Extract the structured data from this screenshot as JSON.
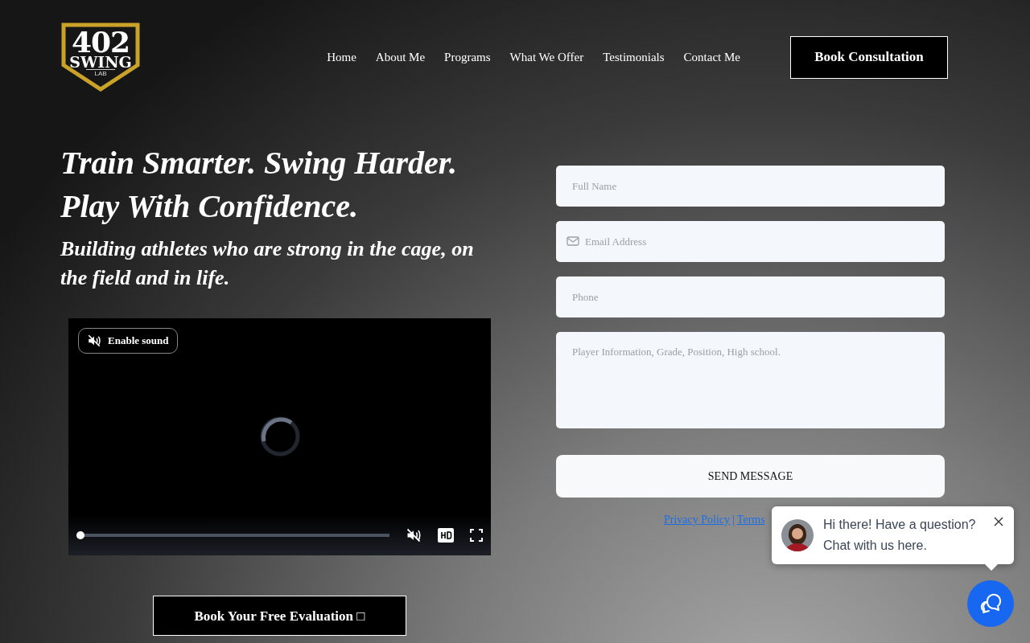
{
  "logo": {
    "number": "402",
    "word": "SWING",
    "sub": "LAB"
  },
  "nav": {
    "items": [
      {
        "label": "Home"
      },
      {
        "label": "About Me"
      },
      {
        "label": "Programs"
      },
      {
        "label": "What We Offer"
      },
      {
        "label": "Testimonials"
      },
      {
        "label": "Contact Me"
      }
    ],
    "cta": "Book Consultation"
  },
  "hero": {
    "headline": [
      "Train Smarter. Swing Harder.",
      "Play With Confidence."
    ],
    "subhead": "Building athletes who are strong in the cage, on the field and in life."
  },
  "video": {
    "sound_button": "Enable sound",
    "progress": {
      "level": 0
    }
  },
  "evaluation_button": "Book Your Free Evaluation □",
  "form": {
    "fields": [
      {
        "kind": "text",
        "placeholder": "Full Name"
      },
      {
        "kind": "email",
        "placeholder": "Email Address"
      },
      {
        "kind": "text",
        "placeholder": "Phone"
      },
      {
        "kind": "textarea",
        "placeholder": "Player Information, Grade, Position, High school."
      }
    ],
    "submit": "SEND MESSAGE",
    "links": [
      "Privacy Policy",
      "Terms"
    ],
    "separator": "|"
  },
  "chat": {
    "message": [
      "Hi there! Have a question?",
      "Chat with us here."
    ]
  }
}
